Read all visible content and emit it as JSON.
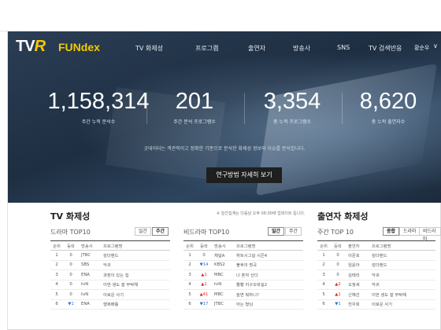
{
  "nav": {
    "logo_left": "TV",
    "logo_r": "R",
    "logo_right": "FUNdex",
    "items": [
      "TV 화제성",
      "프로그램",
      "출연자",
      "방송사",
      "SNS",
      "TV 검색반응"
    ],
    "user": "황순우",
    "chevron": "∨"
  },
  "stats": [
    {
      "value": "1,158,314",
      "label": "주간 누적 분석수"
    },
    {
      "value": "201",
      "label": "주간 분석 프로그램수"
    },
    {
      "value": "3,354",
      "label": "총 누적 프로그램수"
    },
    {
      "value": "8,620",
      "label": "총 누적 출연자수"
    }
  ],
  "hero": {
    "description": "굿데이터는 객관적이고 정확한 기준으로 분석한 화제성 정보와 이슈를 분석합니다.",
    "button": "연구방법 자세히 보기"
  },
  "tv_section": {
    "title": "TV 화제성",
    "note": "※ 일간집계는 다음날 오후 06:00에 업데이트 됩니다."
  },
  "drama": {
    "title": "드라마 TOP10",
    "toggle": [
      "일간",
      "주간"
    ],
    "headers": [
      "순위",
      "등락",
      "방송사",
      "프로그램명"
    ],
    "rows": [
      [
        "1",
        "0",
        "JTBC",
        "킹더랜드"
      ],
      [
        "2",
        "0",
        "SBS",
        "악귀"
      ],
      [
        "3",
        "0",
        "ENA",
        "과장이 있는 집"
      ],
      [
        "4",
        "0",
        "tvN",
        "이번 생도 잘 부탁해"
      ],
      [
        "5",
        "0",
        "tvN",
        "이로운 사기"
      ],
      [
        "6",
        "▼1",
        "ENA",
        "행복배틀"
      ]
    ]
  },
  "nondrama": {
    "title": "비드라마 TOP10",
    "toggle": [
      "일간",
      "주간"
    ],
    "headers": [
      "순위",
      "등락",
      "방송사",
      "프로그램명"
    ],
    "rows": [
      [
        "1",
        "0",
        "채널A",
        "하트시그널 시즌4"
      ],
      [
        "2",
        "▼14",
        "KBS2",
        "불후의 명곡"
      ],
      [
        "3",
        "▲1",
        "MBC",
        "나 혼자 산다"
      ],
      [
        "4",
        "▲1",
        "tvN",
        "뿅뿅 지구오락실2"
      ],
      [
        "5",
        "▲41",
        "MBC",
        "놀면 뭐하니?"
      ],
      [
        "6",
        "▼17",
        "JTBC",
        "아는 형님"
      ]
    ]
  },
  "cast": {
    "section_title": "출연자 화제성",
    "title": "주간 TOP 10",
    "toggle": [
      "종합",
      "드라마",
      "비드라마"
    ],
    "headers": [
      "순위",
      "등락",
      "출연자",
      "프로그램명"
    ],
    "rows": [
      [
        "1",
        "0",
        "이준호",
        "킹더랜드"
      ],
      [
        "2",
        "0",
        "임윤아",
        "킹더랜드"
      ],
      [
        "3",
        "0",
        "김태리",
        "악귀"
      ],
      [
        "4",
        "▲2",
        "오정세",
        "악귀"
      ],
      [
        "5",
        "▲1",
        "신혜선",
        "이번 생도 잘 부탁해"
      ],
      [
        "6",
        "▼1",
        "천우희",
        "이로운 사기"
      ]
    ]
  }
}
